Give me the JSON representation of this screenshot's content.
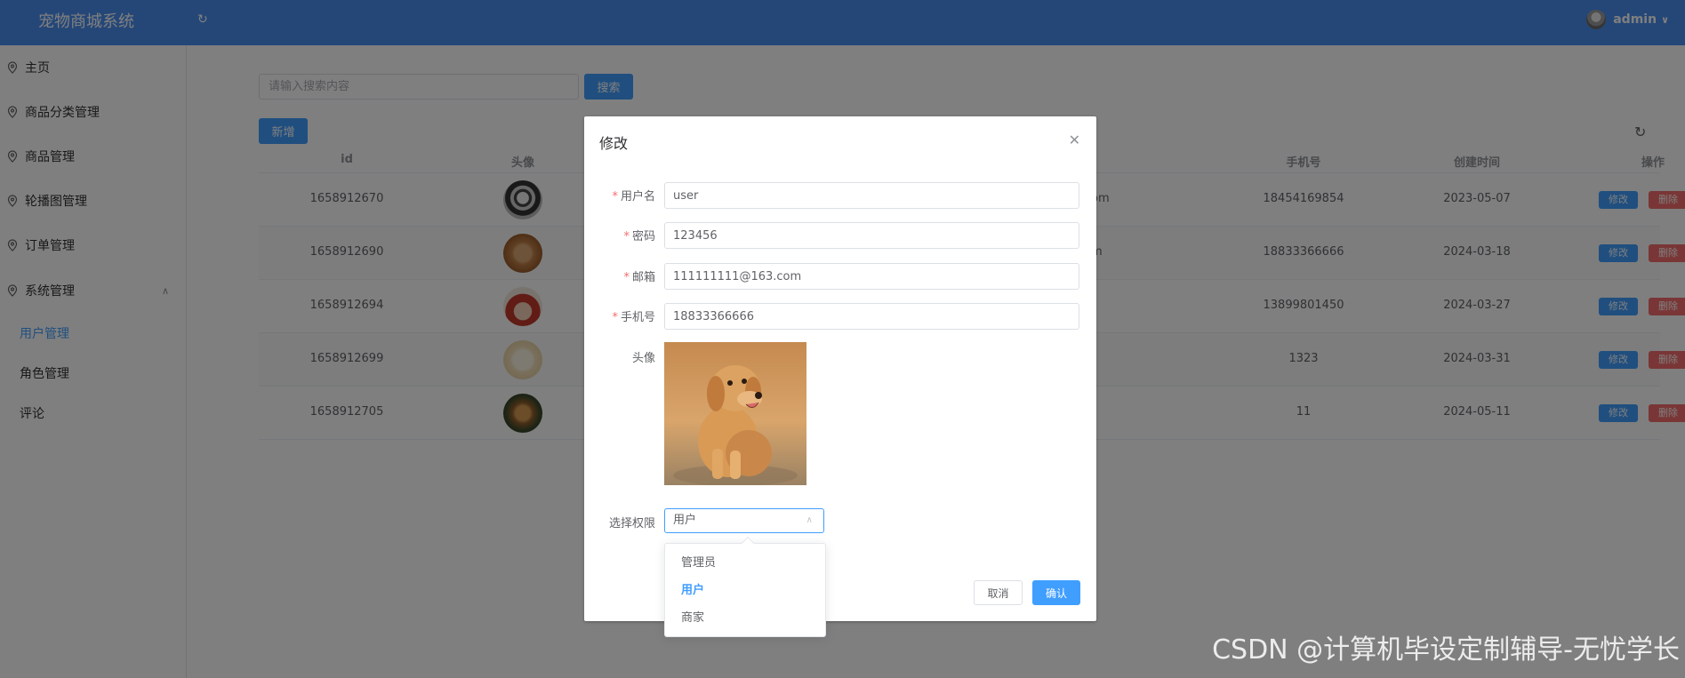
{
  "header": {
    "title": "宠物商城系统",
    "user_name": "admin"
  },
  "sidebar": {
    "items": [
      {
        "label": "主页"
      },
      {
        "label": "商品分类管理"
      },
      {
        "label": "商品管理"
      },
      {
        "label": "轮播图管理"
      },
      {
        "label": "订单管理"
      },
      {
        "label": "系统管理"
      }
    ],
    "sub_items": [
      {
        "label": "用户管理",
        "active": true
      },
      {
        "label": "角色管理"
      },
      {
        "label": "评论"
      }
    ]
  },
  "toolbar": {
    "search_placeholder": "请输入搜索内容",
    "search_label": "搜索",
    "add_label": "新增"
  },
  "table": {
    "headers": [
      "id",
      "头像",
      "手机号",
      "创建时间",
      "操作"
    ],
    "email_fragments": [
      "om",
      "m",
      "",
      "",
      ""
    ],
    "rows": [
      {
        "id": "1658912670",
        "phone": "18454169854",
        "created": "2023-05-07"
      },
      {
        "id": "1658912690",
        "phone": "18833366666",
        "created": "2024-03-18"
      },
      {
        "id": "1658912694",
        "phone": "13899801450",
        "created": "2024-03-27"
      },
      {
        "id": "1658912699",
        "phone": "1323",
        "created": "2024-03-31"
      },
      {
        "id": "1658912705",
        "phone": "11",
        "created": "2024-05-11"
      }
    ],
    "edit_label": "修改",
    "delete_label": "删除"
  },
  "dialog": {
    "title": "修改",
    "labels": {
      "username": "用户名",
      "password": "密码",
      "email": "邮箱",
      "phone": "手机号",
      "avatar": "头像",
      "role": "选择权限"
    },
    "values": {
      "username": "user",
      "password": "123456",
      "email": "111111111@163.com",
      "phone": "18833366666",
      "role": "用户"
    },
    "cancel_label": "取消",
    "confirm_label": "确认"
  },
  "role_options": [
    {
      "label": "管理员"
    },
    {
      "label": "用户",
      "selected": true
    },
    {
      "label": "商家"
    }
  ],
  "watermark": "CSDN @计算机毕设定制辅导-无忧学长",
  "colors": {
    "header_bg": "#4a8ff0",
    "primary": "#409eff",
    "danger": "#f56c6c"
  }
}
